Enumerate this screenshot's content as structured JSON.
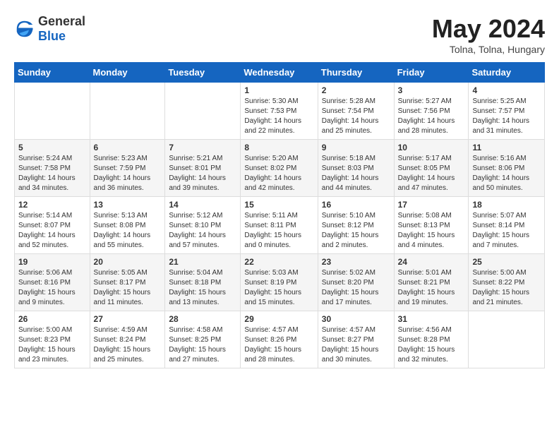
{
  "header": {
    "logo_general": "General",
    "logo_blue": "Blue",
    "month_year": "May 2024",
    "location": "Tolna, Tolna, Hungary"
  },
  "weekdays": [
    "Sunday",
    "Monday",
    "Tuesday",
    "Wednesday",
    "Thursday",
    "Friday",
    "Saturday"
  ],
  "weeks": [
    [
      {
        "day": "",
        "info": ""
      },
      {
        "day": "",
        "info": ""
      },
      {
        "day": "",
        "info": ""
      },
      {
        "day": "1",
        "info": "Sunrise: 5:30 AM\nSunset: 7:53 PM\nDaylight: 14 hours\nand 22 minutes."
      },
      {
        "day": "2",
        "info": "Sunrise: 5:28 AM\nSunset: 7:54 PM\nDaylight: 14 hours\nand 25 minutes."
      },
      {
        "day": "3",
        "info": "Sunrise: 5:27 AM\nSunset: 7:56 PM\nDaylight: 14 hours\nand 28 minutes."
      },
      {
        "day": "4",
        "info": "Sunrise: 5:25 AM\nSunset: 7:57 PM\nDaylight: 14 hours\nand 31 minutes."
      }
    ],
    [
      {
        "day": "5",
        "info": "Sunrise: 5:24 AM\nSunset: 7:58 PM\nDaylight: 14 hours\nand 34 minutes."
      },
      {
        "day": "6",
        "info": "Sunrise: 5:23 AM\nSunset: 7:59 PM\nDaylight: 14 hours\nand 36 minutes."
      },
      {
        "day": "7",
        "info": "Sunrise: 5:21 AM\nSunset: 8:01 PM\nDaylight: 14 hours\nand 39 minutes."
      },
      {
        "day": "8",
        "info": "Sunrise: 5:20 AM\nSunset: 8:02 PM\nDaylight: 14 hours\nand 42 minutes."
      },
      {
        "day": "9",
        "info": "Sunrise: 5:18 AM\nSunset: 8:03 PM\nDaylight: 14 hours\nand 44 minutes."
      },
      {
        "day": "10",
        "info": "Sunrise: 5:17 AM\nSunset: 8:05 PM\nDaylight: 14 hours\nand 47 minutes."
      },
      {
        "day": "11",
        "info": "Sunrise: 5:16 AM\nSunset: 8:06 PM\nDaylight: 14 hours\nand 50 minutes."
      }
    ],
    [
      {
        "day": "12",
        "info": "Sunrise: 5:14 AM\nSunset: 8:07 PM\nDaylight: 14 hours\nand 52 minutes."
      },
      {
        "day": "13",
        "info": "Sunrise: 5:13 AM\nSunset: 8:08 PM\nDaylight: 14 hours\nand 55 minutes."
      },
      {
        "day": "14",
        "info": "Sunrise: 5:12 AM\nSunset: 8:10 PM\nDaylight: 14 hours\nand 57 minutes."
      },
      {
        "day": "15",
        "info": "Sunrise: 5:11 AM\nSunset: 8:11 PM\nDaylight: 15 hours\nand 0 minutes."
      },
      {
        "day": "16",
        "info": "Sunrise: 5:10 AM\nSunset: 8:12 PM\nDaylight: 15 hours\nand 2 minutes."
      },
      {
        "day": "17",
        "info": "Sunrise: 5:08 AM\nSunset: 8:13 PM\nDaylight: 15 hours\nand 4 minutes."
      },
      {
        "day": "18",
        "info": "Sunrise: 5:07 AM\nSunset: 8:14 PM\nDaylight: 15 hours\nand 7 minutes."
      }
    ],
    [
      {
        "day": "19",
        "info": "Sunrise: 5:06 AM\nSunset: 8:16 PM\nDaylight: 15 hours\nand 9 minutes."
      },
      {
        "day": "20",
        "info": "Sunrise: 5:05 AM\nSunset: 8:17 PM\nDaylight: 15 hours\nand 11 minutes."
      },
      {
        "day": "21",
        "info": "Sunrise: 5:04 AM\nSunset: 8:18 PM\nDaylight: 15 hours\nand 13 minutes."
      },
      {
        "day": "22",
        "info": "Sunrise: 5:03 AM\nSunset: 8:19 PM\nDaylight: 15 hours\nand 15 minutes."
      },
      {
        "day": "23",
        "info": "Sunrise: 5:02 AM\nSunset: 8:20 PM\nDaylight: 15 hours\nand 17 minutes."
      },
      {
        "day": "24",
        "info": "Sunrise: 5:01 AM\nSunset: 8:21 PM\nDaylight: 15 hours\nand 19 minutes."
      },
      {
        "day": "25",
        "info": "Sunrise: 5:00 AM\nSunset: 8:22 PM\nDaylight: 15 hours\nand 21 minutes."
      }
    ],
    [
      {
        "day": "26",
        "info": "Sunrise: 5:00 AM\nSunset: 8:23 PM\nDaylight: 15 hours\nand 23 minutes."
      },
      {
        "day": "27",
        "info": "Sunrise: 4:59 AM\nSunset: 8:24 PM\nDaylight: 15 hours\nand 25 minutes."
      },
      {
        "day": "28",
        "info": "Sunrise: 4:58 AM\nSunset: 8:25 PM\nDaylight: 15 hours\nand 27 minutes."
      },
      {
        "day": "29",
        "info": "Sunrise: 4:57 AM\nSunset: 8:26 PM\nDaylight: 15 hours\nand 28 minutes."
      },
      {
        "day": "30",
        "info": "Sunrise: 4:57 AM\nSunset: 8:27 PM\nDaylight: 15 hours\nand 30 minutes."
      },
      {
        "day": "31",
        "info": "Sunrise: 4:56 AM\nSunset: 8:28 PM\nDaylight: 15 hours\nand 32 minutes."
      },
      {
        "day": "",
        "info": ""
      }
    ]
  ]
}
